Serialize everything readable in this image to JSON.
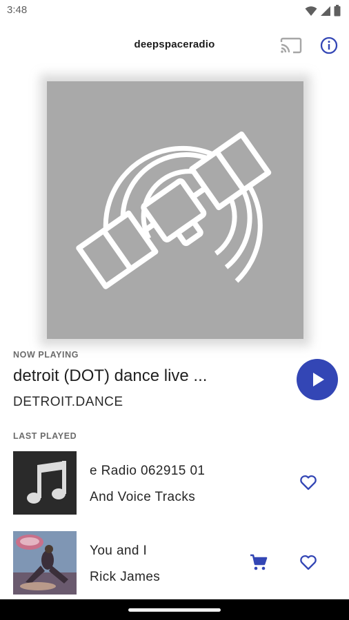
{
  "status_bar": {
    "time": "3:48"
  },
  "app_bar": {
    "title": "deepspaceradio"
  },
  "now_playing": {
    "label": "NOW PLAYING",
    "title": "detroit (DOT) dance live  ...",
    "station": "DETROIT.DANCE"
  },
  "last_played": {
    "label": "LAST PLAYED",
    "tracks": [
      {
        "title": "e Radio 062915 01",
        "artist": "And Voice Tracks"
      },
      {
        "title": "You and I",
        "artist": "Rick James"
      }
    ]
  },
  "colors": {
    "accent": "#3346b5",
    "artwork_bg": "#a9a9a9"
  }
}
